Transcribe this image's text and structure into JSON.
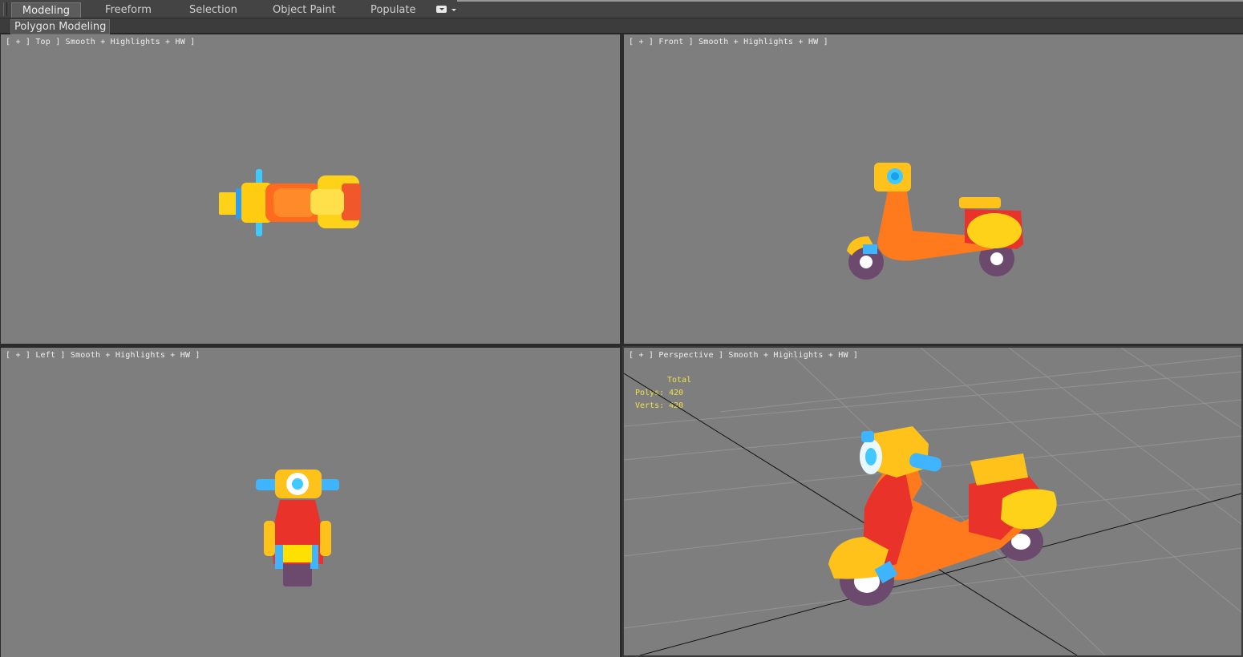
{
  "ribbon": {
    "tabs": [
      {
        "label": "Modeling",
        "active": true
      },
      {
        "label": "Freeform"
      },
      {
        "label": "Selection"
      },
      {
        "label": "Object Paint"
      },
      {
        "label": "Populate"
      }
    ],
    "menu_icon": "ribbon-options-icon"
  },
  "subbar": {
    "panel": "Polygon Modeling"
  },
  "viewports": {
    "top": {
      "label": "[ + ] Top ] Smooth + Highlights + HW ]"
    },
    "front": {
      "label": "[ + ] Front ] Smooth + Highlights + HW ]"
    },
    "left": {
      "label": "[ + ] Left ] Smooth + Highlights + HW ]"
    },
    "persp": {
      "label": "[ + ] Perspective ] Smooth + Highlights + HW ]"
    }
  },
  "stats": {
    "total": "Total",
    "polys": "Polys: 420",
    "verts": "Verts: 420"
  },
  "colors": {
    "viewport_bg": "#7e7e7e",
    "stats_text": "#f0e04a",
    "body_red": "#e8322a",
    "body_orange": "#ff7a1c",
    "accent_yellow": "#ffd21a",
    "accent_blue": "#3fb4ff",
    "wheel_purple": "#6b4a6e"
  }
}
